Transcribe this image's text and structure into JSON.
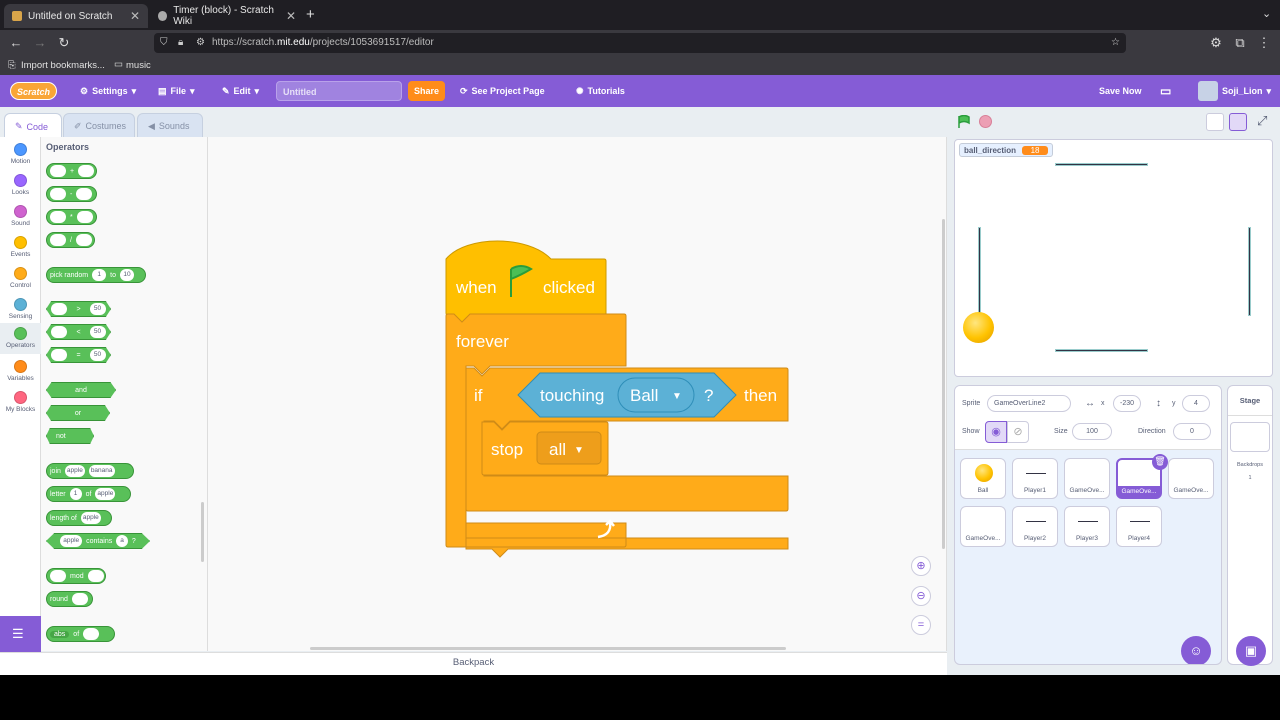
{
  "browser": {
    "tabs": [
      {
        "title": "Untitled on Scratch",
        "active": true
      },
      {
        "title": "Timer (block) - Scratch Wiki",
        "active": false
      }
    ],
    "new_tab": "+",
    "url_prefix": "https://scratch.",
    "url_domain": "mit.edu",
    "url_rest": "/projects/1053691517/editor",
    "bookmarks": [
      "Import bookmarks...",
      "music"
    ]
  },
  "menubar": {
    "logo": "Scratch",
    "settings": "Settings",
    "file": "File",
    "edit": "Edit",
    "project_title": "Untitled",
    "share": "Share",
    "see_project_page": "See Project Page",
    "tutorials": "Tutorials",
    "save_now": "Save Now",
    "username": "Soji_Lion",
    "accent": "#855cd6"
  },
  "editor_tabs": [
    "Code",
    "Costumes",
    "Sounds"
  ],
  "categories": [
    {
      "label": "Motion",
      "color": "#4c97ff"
    },
    {
      "label": "Looks",
      "color": "#9966ff"
    },
    {
      "label": "Sound",
      "color": "#cf63cf"
    },
    {
      "label": "Events",
      "color": "#ffbf00"
    },
    {
      "label": "Control",
      "color": "#ffab19"
    },
    {
      "label": "Sensing",
      "color": "#5cb1d6"
    },
    {
      "label": "Operators",
      "color": "#59c059"
    },
    {
      "label": "Variables",
      "color": "#ff8c1a"
    },
    {
      "label": "My Blocks",
      "color": "#ff6680"
    }
  ],
  "palette": {
    "title": "Operators",
    "arith": [
      "+",
      "-",
      "*",
      "/"
    ],
    "pick_random": {
      "label": "pick random",
      "a": "1",
      "to": "to",
      "b": "10"
    },
    "compare": [
      ">",
      "<",
      "="
    ],
    "compare_value": "50",
    "logic": [
      "and",
      "or",
      "not"
    ],
    "join": {
      "label": "join",
      "a": "apple",
      "b": "banana"
    },
    "letter": {
      "label": "letter",
      "a": "1",
      "of": "of",
      "b": "apple"
    },
    "length": {
      "label": "length of",
      "a": "apple"
    },
    "contains": {
      "a": "apple",
      "label": "contains",
      "b": "a",
      "q": "?"
    },
    "mod": "mod",
    "round": "round",
    "abs": {
      "label": "abs",
      "of": "of"
    }
  },
  "script": {
    "when": "when",
    "clicked": "clicked",
    "forever": "forever",
    "if": "if",
    "touching": "touching",
    "touch_target": "Ball",
    "q": "?",
    "then": "then",
    "stop": "stop",
    "stop_option": "all"
  },
  "backpack": "Backpack",
  "stage": {
    "variable_name": "ball_direction",
    "variable_value": "18"
  },
  "sprite_info": {
    "sprite_label": "Sprite",
    "sprite_name": "GameOverLine2",
    "x_label": "x",
    "x": "-230",
    "y_label": "y",
    "y": "4",
    "show_label": "Show",
    "size_label": "Size",
    "size": "100",
    "direction_label": "Direction",
    "direction": "0"
  },
  "sprites": [
    "Ball",
    "Player1",
    "GameOve...",
    "GameOve...",
    "GameOve...",
    "GameOve...",
    "Player2",
    "Player3",
    "Player4"
  ],
  "stage_panel": {
    "title": "Stage",
    "backdrops_label": "Backdrops",
    "backdrops_count": "1"
  }
}
